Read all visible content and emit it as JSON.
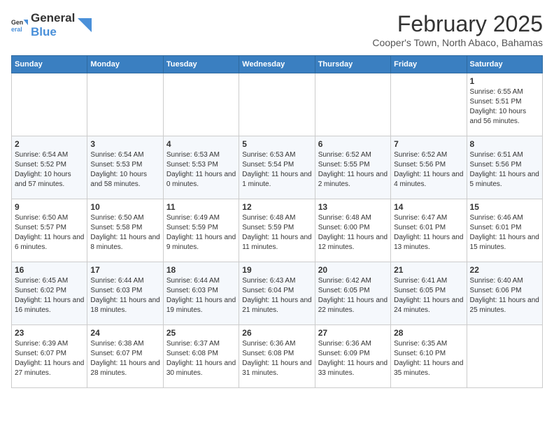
{
  "logo": {
    "general": "General",
    "blue": "Blue"
  },
  "title": {
    "month": "February 2025",
    "location": "Cooper's Town, North Abaco, Bahamas"
  },
  "weekdays": [
    "Sunday",
    "Monday",
    "Tuesday",
    "Wednesday",
    "Thursday",
    "Friday",
    "Saturday"
  ],
  "weeks": [
    [
      {
        "day": "",
        "info": ""
      },
      {
        "day": "",
        "info": ""
      },
      {
        "day": "",
        "info": ""
      },
      {
        "day": "",
        "info": ""
      },
      {
        "day": "",
        "info": ""
      },
      {
        "day": "",
        "info": ""
      },
      {
        "day": "1",
        "info": "Sunrise: 6:55 AM\nSunset: 5:51 PM\nDaylight: 10 hours and 56 minutes."
      }
    ],
    [
      {
        "day": "2",
        "info": "Sunrise: 6:54 AM\nSunset: 5:52 PM\nDaylight: 10 hours and 57 minutes."
      },
      {
        "day": "3",
        "info": "Sunrise: 6:54 AM\nSunset: 5:53 PM\nDaylight: 10 hours and 58 minutes."
      },
      {
        "day": "4",
        "info": "Sunrise: 6:53 AM\nSunset: 5:53 PM\nDaylight: 11 hours and 0 minutes."
      },
      {
        "day": "5",
        "info": "Sunrise: 6:53 AM\nSunset: 5:54 PM\nDaylight: 11 hours and 1 minute."
      },
      {
        "day": "6",
        "info": "Sunrise: 6:52 AM\nSunset: 5:55 PM\nDaylight: 11 hours and 2 minutes."
      },
      {
        "day": "7",
        "info": "Sunrise: 6:52 AM\nSunset: 5:56 PM\nDaylight: 11 hours and 4 minutes."
      },
      {
        "day": "8",
        "info": "Sunrise: 6:51 AM\nSunset: 5:56 PM\nDaylight: 11 hours and 5 minutes."
      }
    ],
    [
      {
        "day": "9",
        "info": "Sunrise: 6:50 AM\nSunset: 5:57 PM\nDaylight: 11 hours and 6 minutes."
      },
      {
        "day": "10",
        "info": "Sunrise: 6:50 AM\nSunset: 5:58 PM\nDaylight: 11 hours and 8 minutes."
      },
      {
        "day": "11",
        "info": "Sunrise: 6:49 AM\nSunset: 5:59 PM\nDaylight: 11 hours and 9 minutes."
      },
      {
        "day": "12",
        "info": "Sunrise: 6:48 AM\nSunset: 5:59 PM\nDaylight: 11 hours and 11 minutes."
      },
      {
        "day": "13",
        "info": "Sunrise: 6:48 AM\nSunset: 6:00 PM\nDaylight: 11 hours and 12 minutes."
      },
      {
        "day": "14",
        "info": "Sunrise: 6:47 AM\nSunset: 6:01 PM\nDaylight: 11 hours and 13 minutes."
      },
      {
        "day": "15",
        "info": "Sunrise: 6:46 AM\nSunset: 6:01 PM\nDaylight: 11 hours and 15 minutes."
      }
    ],
    [
      {
        "day": "16",
        "info": "Sunrise: 6:45 AM\nSunset: 6:02 PM\nDaylight: 11 hours and 16 minutes."
      },
      {
        "day": "17",
        "info": "Sunrise: 6:44 AM\nSunset: 6:03 PM\nDaylight: 11 hours and 18 minutes."
      },
      {
        "day": "18",
        "info": "Sunrise: 6:44 AM\nSunset: 6:03 PM\nDaylight: 11 hours and 19 minutes."
      },
      {
        "day": "19",
        "info": "Sunrise: 6:43 AM\nSunset: 6:04 PM\nDaylight: 11 hours and 21 minutes."
      },
      {
        "day": "20",
        "info": "Sunrise: 6:42 AM\nSunset: 6:05 PM\nDaylight: 11 hours and 22 minutes."
      },
      {
        "day": "21",
        "info": "Sunrise: 6:41 AM\nSunset: 6:05 PM\nDaylight: 11 hours and 24 minutes."
      },
      {
        "day": "22",
        "info": "Sunrise: 6:40 AM\nSunset: 6:06 PM\nDaylight: 11 hours and 25 minutes."
      }
    ],
    [
      {
        "day": "23",
        "info": "Sunrise: 6:39 AM\nSunset: 6:07 PM\nDaylight: 11 hours and 27 minutes."
      },
      {
        "day": "24",
        "info": "Sunrise: 6:38 AM\nSunset: 6:07 PM\nDaylight: 11 hours and 28 minutes."
      },
      {
        "day": "25",
        "info": "Sunrise: 6:37 AM\nSunset: 6:08 PM\nDaylight: 11 hours and 30 minutes."
      },
      {
        "day": "26",
        "info": "Sunrise: 6:36 AM\nSunset: 6:08 PM\nDaylight: 11 hours and 31 minutes."
      },
      {
        "day": "27",
        "info": "Sunrise: 6:36 AM\nSunset: 6:09 PM\nDaylight: 11 hours and 33 minutes."
      },
      {
        "day": "28",
        "info": "Sunrise: 6:35 AM\nSunset: 6:10 PM\nDaylight: 11 hours and 35 minutes."
      },
      {
        "day": "",
        "info": ""
      }
    ]
  ]
}
